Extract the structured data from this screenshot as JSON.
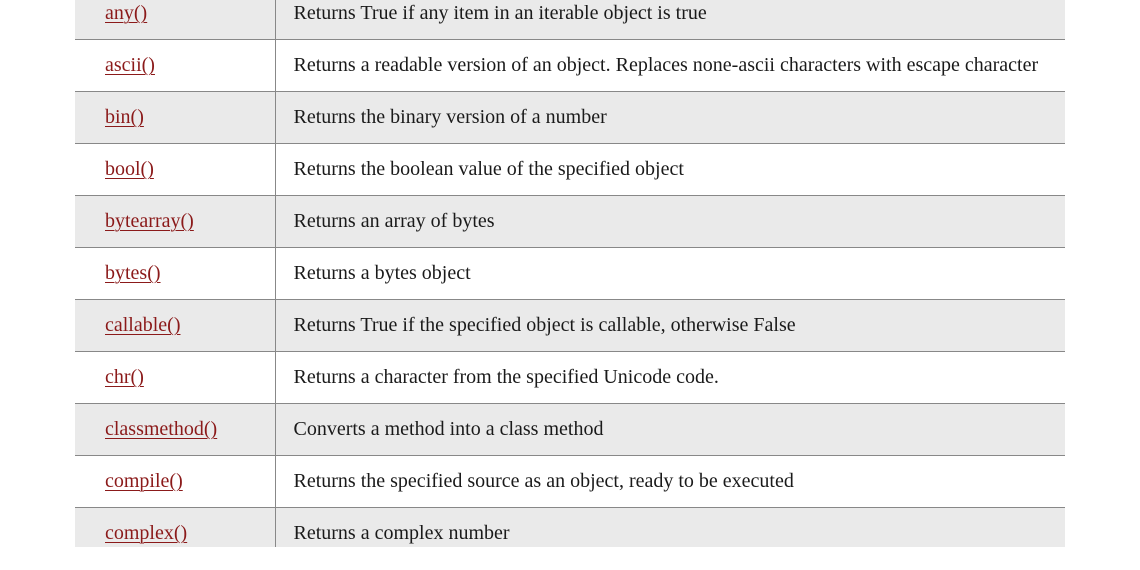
{
  "rows": [
    {
      "func": "any()",
      "desc": "Returns True if any item in an iterable object is true"
    },
    {
      "func": "ascii()",
      "desc": "Returns a readable version of an object. Replaces none-ascii characters with escape character"
    },
    {
      "func": "bin()",
      "desc": "Returns the binary version of a number"
    },
    {
      "func": "bool()",
      "desc": "Returns the boolean value of the specified object"
    },
    {
      "func": "bytearray()",
      "desc": "Returns an array of bytes"
    },
    {
      "func": "bytes()",
      "desc": "Returns a bytes object"
    },
    {
      "func": "callable()",
      "desc": "Returns True if the specified object is callable, otherwise False"
    },
    {
      "func": "chr()",
      "desc": "Returns a character from the specified Unicode code."
    },
    {
      "func": "classmethod()",
      "desc": "Converts a method into a class method"
    },
    {
      "func": "compile()",
      "desc": "Returns the specified source as an object, ready to be executed"
    },
    {
      "func": "complex()",
      "desc": "Returns a complex number"
    }
  ]
}
